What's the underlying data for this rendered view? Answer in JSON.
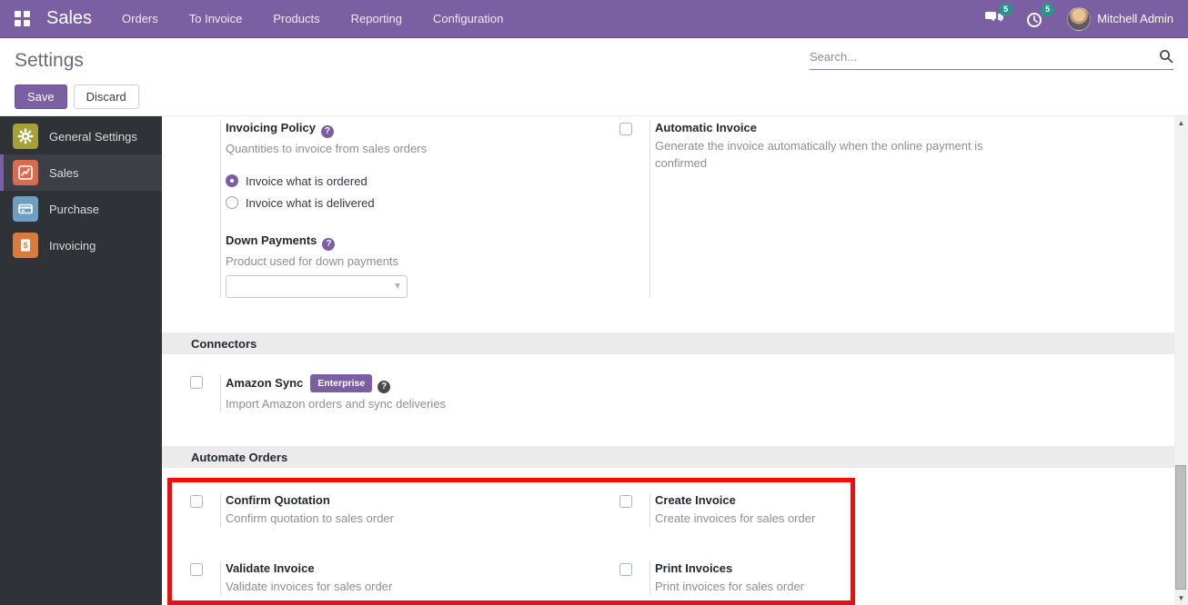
{
  "topnav": {
    "brand": "Sales",
    "menus": [
      "Orders",
      "To Invoice",
      "Products",
      "Reporting",
      "Configuration"
    ],
    "messages_badge": "5",
    "activities_badge": "5",
    "user": "Mitchell Admin"
  },
  "header": {
    "title": "Settings",
    "search_placeholder": "Search...",
    "save": "Save",
    "discard": "Discard"
  },
  "sidebar": {
    "items": [
      {
        "label": "General Settings",
        "icon": "gear",
        "active": false
      },
      {
        "label": "Sales",
        "icon": "sales-chart",
        "active": true
      },
      {
        "label": "Purchase",
        "icon": "credit-card",
        "active": false
      },
      {
        "label": "Invoicing",
        "icon": "invoice-doc",
        "active": false
      }
    ]
  },
  "content": {
    "invoicing_policy": {
      "title": "Invoicing Policy",
      "desc": "Quantities to invoice from sales orders",
      "options": [
        {
          "label": "Invoice what is ordered",
          "selected": true
        },
        {
          "label": "Invoice what is delivered",
          "selected": false
        }
      ]
    },
    "automatic_invoice": {
      "title": "Automatic Invoice",
      "desc": "Generate the invoice automatically when the online payment is confirmed",
      "checked": false
    },
    "down_payments": {
      "title": "Down Payments",
      "desc": "Product used for down payments",
      "select_value": ""
    },
    "sections": {
      "connectors": "Connectors",
      "automate_orders": "Automate Orders"
    },
    "amazon_sync": {
      "title": "Amazon Sync",
      "badge": "Enterprise",
      "desc": "Import Amazon orders and sync deliveries",
      "checked": false
    },
    "automate_items": [
      {
        "title": "Confirm Quotation",
        "desc": "Confirm quotation to sales order",
        "checked": false
      },
      {
        "title": "Create Invoice",
        "desc": "Create invoices for sales order",
        "checked": false
      },
      {
        "title": "Validate Invoice",
        "desc": "Validate invoices for sales order",
        "checked": false
      },
      {
        "title": "Print Invoices",
        "desc": "Print invoices for sales order",
        "checked": false
      }
    ]
  },
  "icons": {
    "help": "?",
    "caret": "▾",
    "arrow_up": "▲",
    "arrow_down": "▼"
  },
  "colors": {
    "accent_purple": "#7A5FA3",
    "badge_teal": "#2A948C",
    "highlight_red": "#EE0E0E",
    "icon_general_settings": "#A4A139",
    "icon_sales": "#D96B4E",
    "icon_purchase": "#6E9EC2",
    "icon_invoicing": "#D97B3F"
  }
}
